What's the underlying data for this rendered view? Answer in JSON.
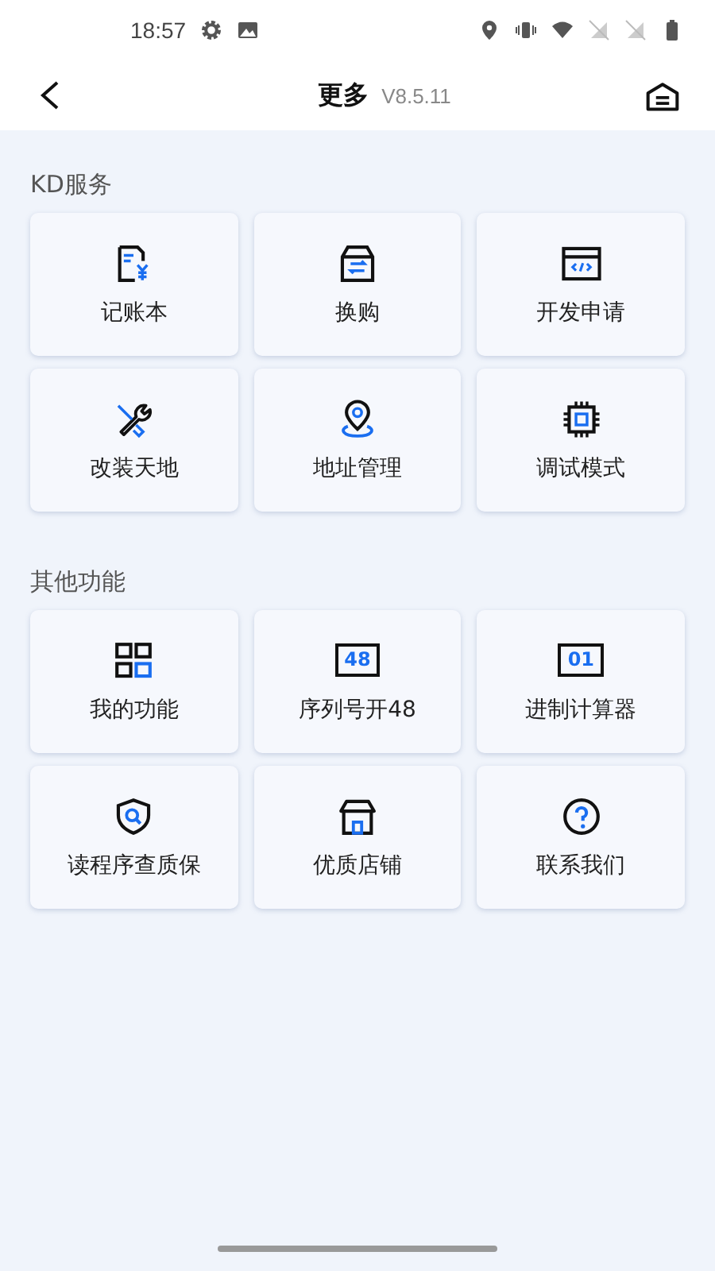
{
  "status_bar": {
    "time": "18:57"
  },
  "header": {
    "title": "更多",
    "version": "V8.5.11"
  },
  "sections": [
    {
      "title": "KD服务",
      "items": [
        {
          "label": "记账本"
        },
        {
          "label": "换购"
        },
        {
          "label": "开发申请"
        },
        {
          "label": "改装天地"
        },
        {
          "label": "地址管理"
        },
        {
          "label": "调试模式"
        }
      ]
    },
    {
      "title": "其他功能",
      "items": [
        {
          "label": "我的功能"
        },
        {
          "label": "序列号开48",
          "icon_text": "48"
        },
        {
          "label": "进制计算器",
          "icon_text": "01"
        },
        {
          "label": "读程序查质保"
        },
        {
          "label": "优质店铺"
        },
        {
          "label": "联系我们"
        }
      ]
    }
  ]
}
